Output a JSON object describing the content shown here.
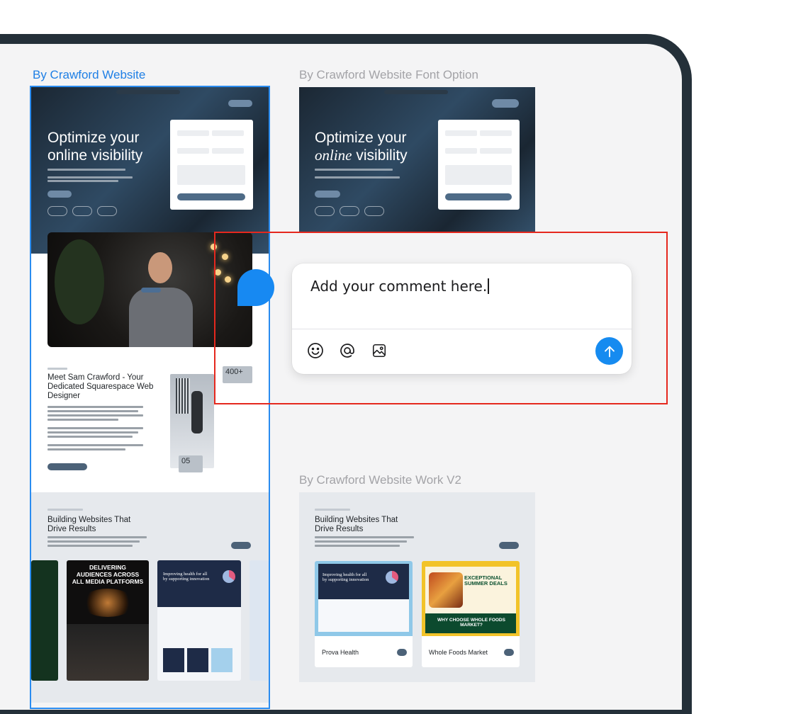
{
  "frames": {
    "selected": {
      "label": "By Crawford Website"
    },
    "font_option": {
      "label": "By Crawford Website Font Option"
    },
    "work_v2": {
      "label": "By Crawford Website Work V2"
    }
  },
  "hero": {
    "headline_line1": "Optimize your",
    "headline_line2": "online visibility",
    "headline_alt_line2_italic": "online",
    "headline_alt_line2_rest": " visibility"
  },
  "about": {
    "heading": "Meet Sam Crawford - Your Dedicated Squarespace Web Designer",
    "stat_top": "400+",
    "stat_bottom": "05"
  },
  "work": {
    "heading_line1": "Building Websites That",
    "heading_line2": "Drive Results",
    "card_banner": "DELIVERING AUDIENCES ACROSS ALL MEDIA PLATFORMS",
    "card_health": "Improving health for all by supporting innovation",
    "card_exceptional": "EXCEPTIONAL SUMMER DEALS",
    "card_whole": "WHY CHOOSE WHOLE FOODS MARKET?",
    "card1_title": "Prova Health",
    "card2_title": "Whole Foods Market"
  },
  "comment": {
    "input_value": "Add your comment here.",
    "icons": [
      "smiley-icon",
      "at-mention-icon",
      "image-icon",
      "send-arrow-icon"
    ]
  },
  "colors": {
    "selection": "#2a8cf0",
    "highlight": "#e5281e",
    "send": "#168bf0"
  }
}
